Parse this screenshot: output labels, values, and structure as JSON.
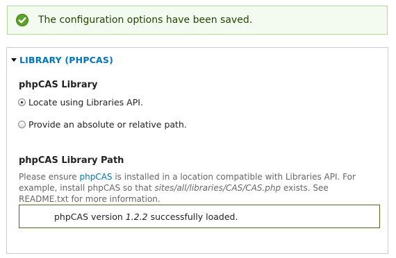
{
  "status": {
    "message": "The configuration options have been saved.",
    "icon": "checkmark-circle-icon",
    "color": "#5ca227"
  },
  "fieldset": {
    "legend": "LIBRARY (PHPCAS)",
    "library_title": "phpCAS Library",
    "options": [
      {
        "label": "Locate using Libraries API.",
        "checked": true
      },
      {
        "label": "Provide an absolute or relative path.",
        "checked": false
      }
    ],
    "path_title": "phpCAS Library Path",
    "description": {
      "part1": "Please ensure ",
      "link": "phpCAS",
      "part2": " is installed in a location compatible with Libraries API. For example, install phpCAS so that ",
      "path": "sites/all/libraries/CAS/CAS.php",
      "part3": " exists. See README.txt for more information."
    },
    "loaded_message": {
      "prefix": "phpCAS version",
      "version": "1.2.2",
      "suffix": "successfully loaded."
    }
  },
  "colors": {
    "link": "#0074bd",
    "status_bg": "#f3faef",
    "status_border": "#b6d896"
  }
}
